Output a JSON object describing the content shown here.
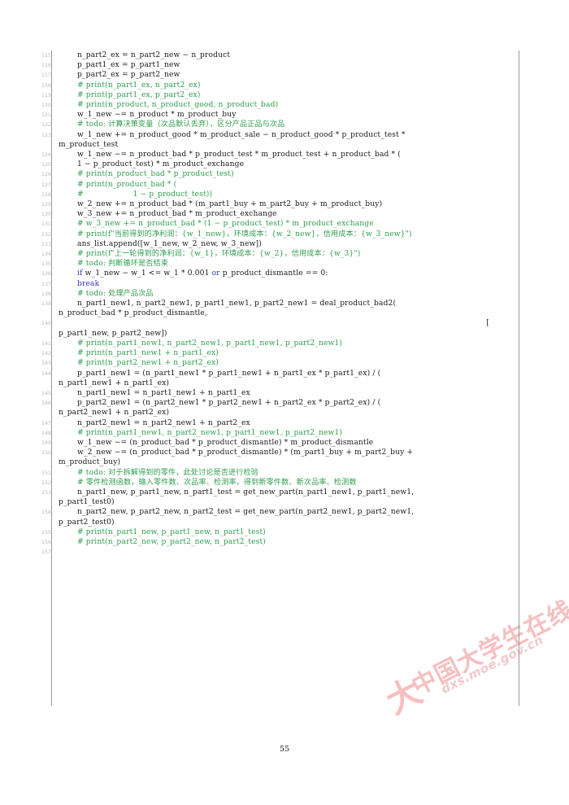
{
  "document": {
    "page_number": "55",
    "language": "python",
    "first_line_number": 115,
    "colors": {
      "comment": "#2f9e4f",
      "keyword": "#3333c4",
      "text": "#1a1a1a",
      "line_number": "#b9b9b9",
      "rule": "#9a9a9a",
      "watermark": "#f6bfc0"
    }
  },
  "watermark": {
    "chinese": "中国大学生在线",
    "url": "dxs.moe.gov.cn",
    "mark": "大"
  },
  "code": [
    {
      "n": "115",
      "indent": "i1",
      "parts": [
        {
          "c": "txt",
          "t": "n_part2_ex = n_part2_new − n_product"
        }
      ]
    },
    {
      "n": "116",
      "indent": "i1",
      "parts": [
        {
          "c": "txt",
          "t": "p_part1_ex = p_part1_new"
        }
      ]
    },
    {
      "n": "117",
      "indent": "i1",
      "parts": [
        {
          "c": "txt",
          "t": "p_part2_ex = p_part2_new"
        }
      ]
    },
    {
      "n": "118",
      "indent": "i1",
      "parts": [
        {
          "c": "com",
          "t": "# print(n_part1_ex, n_part2_ex)"
        }
      ]
    },
    {
      "n": "119",
      "indent": "i1",
      "parts": [
        {
          "c": "com",
          "t": "# print(p_part1_ex, p_part2_ex)"
        }
      ]
    },
    {
      "n": "120",
      "indent": "i1",
      "parts": [
        {
          "c": "com",
          "t": "# print(n_product, n_product_good, n_product_bad)"
        }
      ]
    },
    {
      "n": "121",
      "indent": "i1",
      "parts": [
        {
          "c": "txt",
          "t": "w_1_new −= n_product * m_product_buy"
        }
      ]
    },
    {
      "n": "122",
      "indent": "i1",
      "parts": [
        {
          "c": "com",
          "t": "# todo: 计算决策变量（次品默认丢弃），区分产品正品与次品"
        }
      ]
    },
    {
      "n": "123",
      "indent": "i1",
      "parts": [
        {
          "c": "txt",
          "t": "w_1_new += n_product_good * m_product_sale − n_product_good * p_product_test *"
        }
      ]
    },
    {
      "n": "",
      "indent": "i4",
      "cont": true,
      "parts": [
        {
          "c": "txt",
          "t": "m_product_test"
        }
      ]
    },
    {
      "n": "124",
      "indent": "i1",
      "parts": [
        {
          "c": "txt",
          "t": "w_1_new −= n_product_bad * p_product_test * m_product_test + n_product_bad * ("
        }
      ]
    },
    {
      "n": "125",
      "indent": "i3",
      "parts": [
        {
          "c": "txt",
          "t": "1 − p_product_test) * m_product_exchange"
        }
      ]
    },
    {
      "n": "126",
      "indent": "i1",
      "parts": [
        {
          "c": "com",
          "t": "# print(n_product_bad * p_product_test)"
        }
      ]
    },
    {
      "n": "127",
      "indent": "i1",
      "parts": [
        {
          "c": "com",
          "t": "# print(n_product_bad * ("
        }
      ]
    },
    {
      "n": "128",
      "indent": "i1",
      "parts": [
        {
          "c": "com",
          "t": "#                    1 − p_product_test))"
        }
      ]
    },
    {
      "n": "129",
      "indent": "i1",
      "parts": [
        {
          "c": "txt",
          "t": "w_2_new += n_product_bad * (m_part1_buy + m_part2_buy + m_product_buy)"
        }
      ]
    },
    {
      "n": "130",
      "indent": "i1",
      "parts": [
        {
          "c": "txt",
          "t": "w_3_new += n_product_bad * m_product_exchange"
        }
      ]
    },
    {
      "n": "131",
      "indent": "i1",
      "parts": [
        {
          "c": "com",
          "t": "# w_3_new += n_product_bad * (1 − p_product_test) * m_product_exchange"
        }
      ]
    },
    {
      "n": "132",
      "indent": "i1",
      "parts": [
        {
          "c": "com",
          "t": "# print(f\"当前得到的净利润：{w_1_new}，环境成本：{w_2_new}，信用成本：{w_3_new}\")"
        }
      ]
    },
    {
      "n": "133",
      "indent": "i1",
      "parts": [
        {
          "c": "txt",
          "t": "ans_list.append([w_1_new, w_2_new, w_3_new])"
        }
      ]
    },
    {
      "n": "134",
      "indent": "i1",
      "parts": [
        {
          "c": "com",
          "t": "# print(f\"上一轮得到的净利润：{w_1}，环境成本：{w_2}，信用成本：{w_3}\")"
        }
      ]
    },
    {
      "n": "135",
      "indent": "i1",
      "parts": [
        {
          "c": "com",
          "t": "# todo: 判断循环是否结束"
        }
      ]
    },
    {
      "n": "136",
      "indent": "i1",
      "parts": [
        {
          "c": "key",
          "t": "if"
        },
        {
          "c": "txt",
          "t": " w_1_new − w_1 <= w_1 * 0.001 "
        },
        {
          "c": "key",
          "t": "or"
        },
        {
          "c": "txt",
          "t": " p_product_dismantle == 0:"
        }
      ]
    },
    {
      "n": "137",
      "indent": "i2",
      "parts": [
        {
          "c": "key",
          "t": "break"
        }
      ]
    },
    {
      "n": "138",
      "indent": "i1",
      "parts": [
        {
          "c": "com",
          "t": "# todo: 处理产品次品"
        }
      ]
    },
    {
      "n": "139",
      "indent": "i1",
      "parts": [
        {
          "c": "txt",
          "t": "n_part1_new1, n_part2_new1, p_part1_new1, p_part2_new1 = deal_product_bad2("
        }
      ]
    },
    {
      "n": "",
      "indent": "i4",
      "cont": true,
      "parts": [
        {
          "c": "txt",
          "t": "n_product_bad * p_product_dismantle,"
        }
      ]
    },
    {
      "n": "140",
      "indent": "i1",
      "align": "right",
      "parts": [
        {
          "c": "txt",
          "t": "["
        }
      ]
    },
    {
      "n": "",
      "indent": "i4",
      "cont": true,
      "parts": [
        {
          "c": "txt",
          "t": "p_part1_new, p_part2_new])"
        }
      ]
    },
    {
      "n": "141",
      "indent": "i1",
      "parts": [
        {
          "c": "com",
          "t": "# print(n_part1_new1, n_part2_new1, p_part1_new1, p_part2_new1)"
        }
      ]
    },
    {
      "n": "142",
      "indent": "i1",
      "parts": [
        {
          "c": "com",
          "t": "# print(n_part1_new1 + n_part1_ex)"
        }
      ]
    },
    {
      "n": "143",
      "indent": "i1",
      "parts": [
        {
          "c": "com",
          "t": "# print(n_part2_new1 + n_part2_ex)"
        }
      ]
    },
    {
      "n": "144",
      "indent": "i1",
      "parts": [
        {
          "c": "txt",
          "t": "p_part1_new1 = (n_part1_new1 * p_part1_new1 + n_part1_ex * p_part1_ex) / ("
        }
      ]
    },
    {
      "n": "",
      "indent": "i4",
      "cont": true,
      "parts": [
        {
          "c": "txt",
          "t": "n_part1_new1 + n_part1_ex)"
        }
      ]
    },
    {
      "n": "145",
      "indent": "i1",
      "parts": [
        {
          "c": "txt",
          "t": "n_part1_new1 = n_part1_new1 + n_part1_ex"
        }
      ]
    },
    {
      "n": "146",
      "indent": "i1",
      "parts": [
        {
          "c": "txt",
          "t": "p_part2_new1 = (n_part2_new1 * p_part2_new1 + n_part2_ex * p_part2_ex) / ("
        }
      ]
    },
    {
      "n": "",
      "indent": "i4",
      "cont": true,
      "parts": [
        {
          "c": "txt",
          "t": "n_part2_new1 + n_part2_ex)"
        }
      ]
    },
    {
      "n": "147",
      "indent": "i1",
      "parts": [
        {
          "c": "txt",
          "t": "n_part2_new1 = n_part2_new1 + n_part2_ex"
        }
      ]
    },
    {
      "n": "148",
      "indent": "i1",
      "parts": [
        {
          "c": "com",
          "t": "# print(n_part1_new1, n_part2_new1, p_part1_new1, p_part2_new1)"
        }
      ]
    },
    {
      "n": "149",
      "indent": "i1",
      "parts": [
        {
          "c": "txt",
          "t": "w_1_new −= (n_product_bad * p_product_dismantle) * m_product_dismantle"
        }
      ]
    },
    {
      "n": "150",
      "indent": "i1",
      "parts": [
        {
          "c": "txt",
          "t": "w_2_new −= (n_product_bad * p_product_dismantle) * (m_part1_buy + m_part2_buy +"
        }
      ]
    },
    {
      "n": "",
      "indent": "i4",
      "cont": true,
      "parts": [
        {
          "c": "txt",
          "t": "m_product_buy)"
        }
      ]
    },
    {
      "n": "151",
      "indent": "i1",
      "parts": [
        {
          "c": "com",
          "t": "# todo: 对于拆解得到的零件，此处讨论是否进行检验"
        }
      ]
    },
    {
      "n": "152",
      "indent": "i1",
      "parts": [
        {
          "c": "com",
          "t": "# 零件检测函数，输入零件数、次品率、检测率，得到新零件数、新次品率、检测数"
        }
      ]
    },
    {
      "n": "153",
      "indent": "i1",
      "parts": [
        {
          "c": "txt",
          "t": "n_part1_new, p_part1_new, n_part1_test = get_new_part(n_part1_new1, p_part1_new1,"
        }
      ]
    },
    {
      "n": "",
      "indent": "i4",
      "cont": true,
      "parts": [
        {
          "c": "txt",
          "t": "p_part1_test0)"
        }
      ]
    },
    {
      "n": "154",
      "indent": "i1",
      "parts": [
        {
          "c": "txt",
          "t": "n_part2_new, p_part2_new, n_part2_test = get_new_part(n_part2_new1, p_part2_new1,"
        }
      ]
    },
    {
      "n": "",
      "indent": "i4",
      "cont": true,
      "parts": [
        {
          "c": "txt",
          "t": "p_part2_test0)"
        }
      ]
    },
    {
      "n": "155",
      "indent": "i1",
      "parts": [
        {
          "c": "com",
          "t": "# print(n_part1_new, p_part1_new, n_part1_test)"
        }
      ]
    },
    {
      "n": "156",
      "indent": "i1",
      "parts": [
        {
          "c": "com",
          "t": "# print(n_part2_new, p_part2_new, n_part2_test)"
        }
      ]
    },
    {
      "n": "157",
      "indent": "i1",
      "parts": [
        {
          "c": "txt",
          "t": ""
        }
      ]
    }
  ]
}
